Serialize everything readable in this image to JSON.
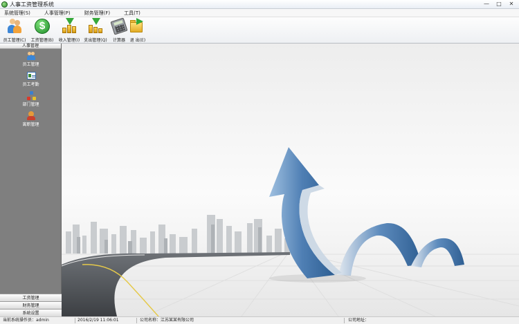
{
  "window": {
    "title": "人事工资管理系统",
    "controls": [
      "—",
      "□",
      "✕"
    ]
  },
  "menu": [
    "系统管理(S)",
    "人事管理(P)",
    "财务管理(F)",
    "工具(T)"
  ],
  "toolbar": [
    {
      "label": "员工管理(C)",
      "icon": "employees-icon"
    },
    {
      "label": "工资管理(B)",
      "icon": "dollar-icon"
    },
    {
      "label": "收入管理(I)",
      "icon": "income-icon"
    },
    {
      "label": "支出管理(Q)",
      "icon": "expense-icon"
    },
    {
      "label": "计算器",
      "icon": "calculator-icon"
    },
    {
      "label": "退 出(E)",
      "icon": "exit-icon"
    }
  ],
  "sidebar": {
    "header": "人事管理",
    "items": [
      {
        "label": "员工管理",
        "icon": "employees-icon"
      },
      {
        "label": "员工考勤",
        "icon": "attendance-card-icon"
      },
      {
        "label": "部门管理",
        "icon": "department-tree-icon"
      },
      {
        "label": "离职管理",
        "icon": "resignation-icon"
      }
    ],
    "bottom": [
      "工资管理",
      "财务管理",
      "系统设置"
    ]
  },
  "status": {
    "operator": "当前系统操作员：admin",
    "datetime": "2016/2/19 11:06:01",
    "company": "公司名称：江苏某某有限公司",
    "address": "公司地址："
  }
}
